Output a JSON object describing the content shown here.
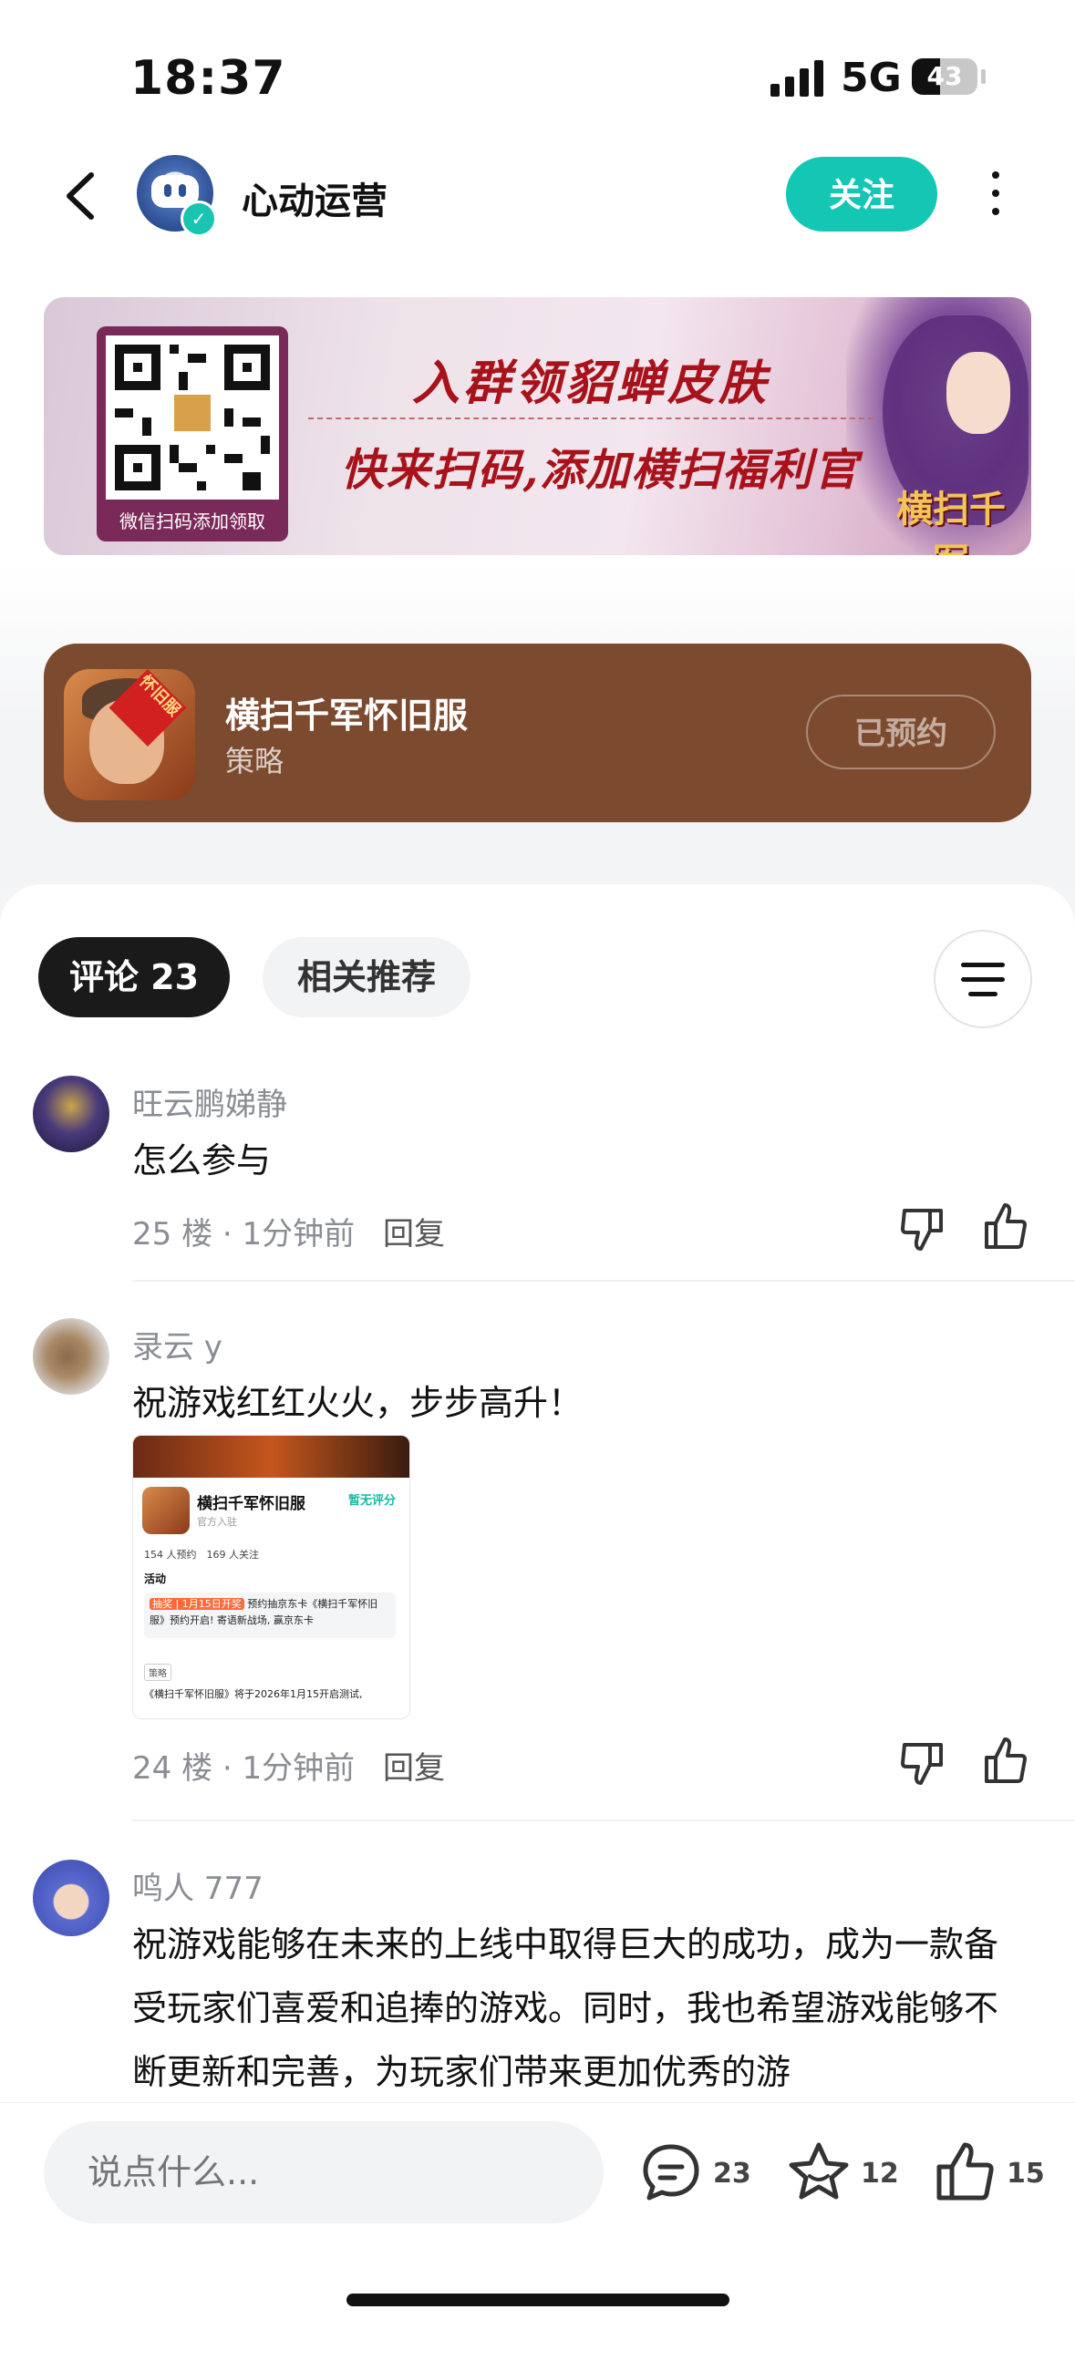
{
  "status_bar": {
    "time": "18:37",
    "network": "5G",
    "battery": "43",
    "battery_level": 0.43
  },
  "header": {
    "account_name": "心动运营",
    "follow_label": "关注"
  },
  "banner": {
    "headline": "入群领貂蝉皮肤",
    "subline": "快来扫码,添加横扫福利官",
    "qr_caption": "微信扫码添加领取",
    "logo_text": "横扫千军"
  },
  "game_card": {
    "title": "横扫千军怀旧服",
    "category": "策略",
    "icon_badge": "怀旧服",
    "button_label": "已预约",
    "background": "#7c4a2e"
  },
  "tabs": {
    "comments_label": "评论 23",
    "related_label": "相关推荐"
  },
  "comments": [
    {
      "user": "旺云鹏娣静",
      "text": "怎么参与",
      "floor": "25 楼",
      "time": "1分钟前",
      "reply_label": "回复"
    },
    {
      "user": "录云 y",
      "text": "祝游戏红红火火，步步高升！",
      "floor": "24 楼",
      "time": "1分钟前",
      "reply_label": "回复",
      "attachment": {
        "title": "横扫千军怀旧服",
        "rating_label": "暂无评分",
        "official": "官方入驻",
        "stats": "154 人预约　169 人关注",
        "activity_label": "活动",
        "activity_tag": "抽奖 | 1月15日开奖",
        "activity_text": "预约抽京东卡《横扫千军怀旧服》预约开启! 寄语新战场, 赢京东卡",
        "category_chip": "策略",
        "description": "《横扫千军怀旧服》将于2026年1月15开启测试,"
      }
    },
    {
      "user": "鸣人 777",
      "text": "祝游戏能够在未来的上线中取得巨大的成功，成为一款备受玩家们喜爱和追捧的游戏。同时，我也希望游戏能够不断更新和完善，为玩家们带来更加优秀的游"
    }
  ],
  "bottom_bar": {
    "input_placeholder": "说点什么...",
    "comment_count": "23",
    "favorite_count": "12",
    "like_count": "15"
  },
  "colors": {
    "accent": "#14c7b4",
    "dark": "#1a1a1a",
    "muted": "#8a8d93"
  }
}
